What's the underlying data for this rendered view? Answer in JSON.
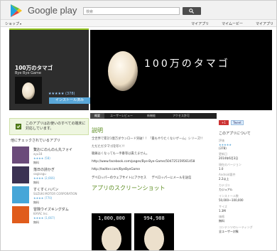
{
  "header": {
    "brand": "Google play",
    "search_placeholder": "検索"
  },
  "nav": {
    "shop": "ショップ",
    "links": [
      "マイアプリ",
      "マイムービー",
      "マイアプリ"
    ]
  },
  "app": {
    "title": "100万のタマゴ",
    "developer": "Bye Bye Game",
    "rating": "★★★★★ (378)",
    "install_label": "インストール済み",
    "banner_text": "100万のタマゴ"
  },
  "notice": {
    "text": "このアプリはお使いのすべての端末に対応しています。"
  },
  "also_installed": {
    "title": "他にチェックされているアプリ",
    "items": [
      {
        "name": "贅おにのんのん丸フォイ",
        "dev": "ayu18",
        "rating": "★★★★ (58)",
        "price": "無料",
        "icon_color": "#6b4b7a"
      },
      {
        "name": "落日の詩かぎ",
        "dev": "sagisagu",
        "rating": "★★★★ (2,666)",
        "price": "無料",
        "icon_color": "#3b3252"
      },
      {
        "name": "すくすくハパン",
        "dev": "SUZUKI MOTOR CORPORATION",
        "rating": "★★★★ (770)",
        "price": "無料",
        "icon_color": "#46a6d8"
      },
      {
        "name": "冒険ウイズキングダム",
        "dev": "KAYAC Inc.",
        "rating": "★★★★ (1,667)",
        "price": "無料",
        "icon_color": "#e05c1c"
      }
    ]
  },
  "tabs": [
    "概要",
    "ユーザーレビュー",
    "新機能",
    "アクセス許可"
  ],
  "description": {
    "heading": "説明",
    "para1": "全世界で累計1億万ダウンロード突破！！「最もやりたくないゲーム」シリーズ!!",
    "para2": "ただただタマゴを叩く!!",
    "para3": "聴痛はくなってもー手番等は責えません。",
    "link1": "http://www.facebook.com/pages/Bye-Bye-Game/504725159561458",
    "link2": "http://twitter.com/ByeByeGame",
    "dev_info": "デベロッパーのウェブサイトにアクセス",
    "dev_email": "デベロッパーにメールを送信"
  },
  "screenshots": {
    "heading": "アプリのスクリーンショット",
    "counts": [
      "1,000,000",
      "994,988"
    ]
  },
  "right": {
    "gplus": "+1",
    "tweet": "Tweet",
    "info_title": "このアプリについて",
    "rating_label": "評価",
    "rating_value": "★★★★★",
    "rating_count": "(378)",
    "updated_label": "更新日",
    "updated_value": "2014年6月3日",
    "version_label": "現在のバージョン",
    "version_value": "1.0",
    "req_label": "Android要件",
    "req_value": "2.2以上",
    "category_label": "カテゴリ",
    "category_value": "カジュアル",
    "installs_label": "インストール数",
    "installs_value": "50,000～100,000",
    "size_label": "サイズ",
    "size_value": "1.3M",
    "price_label": "価格",
    "price_value": "無料",
    "content_label": "コンテンツのレーティング",
    "content_value": "全ユーザー対象"
  }
}
